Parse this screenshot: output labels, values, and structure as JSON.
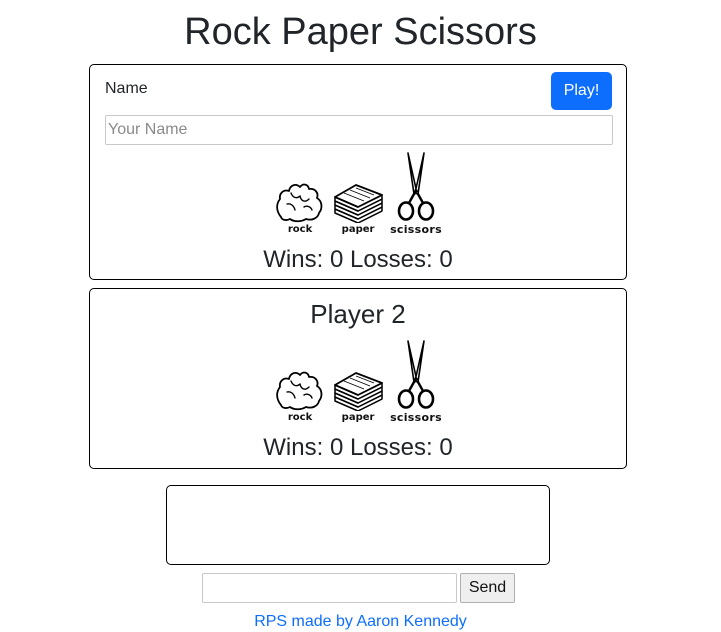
{
  "page": {
    "title": "Rock Paper Scissors"
  },
  "player1": {
    "name_label": "Name",
    "play_button": "Play!",
    "name_input": {
      "value": "",
      "placeholder": "Your Name"
    },
    "choices": [
      {
        "id": "rock",
        "label": "rock",
        "icon": "rock-icon"
      },
      {
        "id": "paper",
        "label": "paper",
        "icon": "paper-icon"
      },
      {
        "id": "scissors",
        "label": "scissors",
        "icon": "scissors-icon"
      }
    ],
    "wins_label": "Wins:",
    "wins": "0",
    "losses_label": "Losses:",
    "losses": "0"
  },
  "player2": {
    "title": "Player 2",
    "choices": [
      {
        "id": "rock",
        "label": "rock",
        "icon": "rock-icon"
      },
      {
        "id": "paper",
        "label": "paper",
        "icon": "paper-icon"
      },
      {
        "id": "scissors",
        "label": "scissors",
        "icon": "scissors-icon"
      }
    ],
    "wins_label": "Wins:",
    "wins": "0",
    "losses_label": "Losses:",
    "losses": "0"
  },
  "chat": {
    "messages": [],
    "input_value": "",
    "send_button": "Send"
  },
  "footer": {
    "link_text": "RPS made by Aaron Kennedy"
  },
  "colors": {
    "accent": "#0d6efd",
    "text": "#212529",
    "border": "#000000"
  }
}
